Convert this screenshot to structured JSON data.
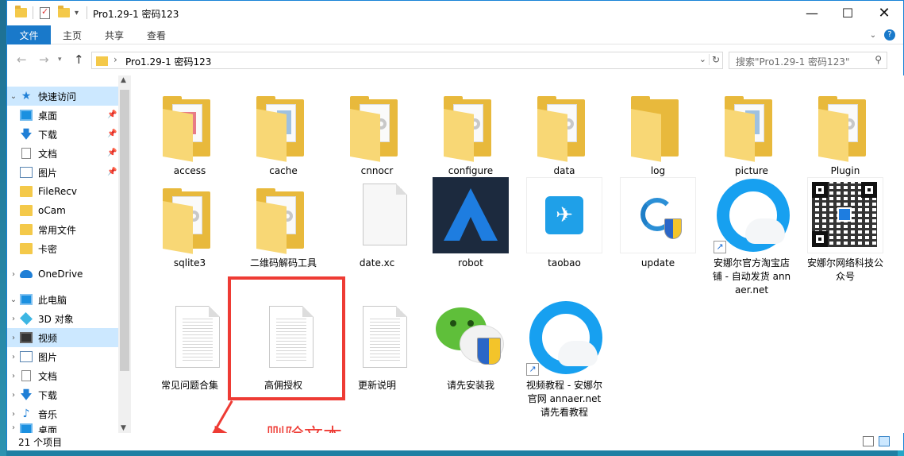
{
  "window": {
    "title": "Pro1.29-1 密码123",
    "controls": [
      "minimize",
      "maximize",
      "close"
    ]
  },
  "ribbon": {
    "tabs": [
      {
        "label": "文件",
        "active": true
      },
      {
        "label": "主页"
      },
      {
        "label": "共享"
      },
      {
        "label": "查看"
      }
    ]
  },
  "address": {
    "path": "Pro1.29-1 密码123",
    "separator": "›"
  },
  "search": {
    "placeholder": "搜索\"Pro1.29-1 密码123\""
  },
  "nav": {
    "quick_access": "快速访问",
    "items": [
      {
        "label": "桌面",
        "pinned": true
      },
      {
        "label": "下载",
        "pinned": true
      },
      {
        "label": "文档",
        "pinned": true
      },
      {
        "label": "图片",
        "pinned": true
      },
      {
        "label": "FileRecv"
      },
      {
        "label": "oCam"
      },
      {
        "label": "常用文件"
      },
      {
        "label": "卡密"
      }
    ],
    "onedrive": "OneDrive",
    "this_pc": "此电脑",
    "pc_items": [
      {
        "label": "3D 对象"
      },
      {
        "label": "视频",
        "selected": true
      },
      {
        "label": "图片"
      },
      {
        "label": "文档"
      },
      {
        "label": "下载"
      },
      {
        "label": "音乐"
      },
      {
        "label": "桌面"
      }
    ]
  },
  "files": [
    {
      "name": "access",
      "type": "folder",
      "variant": "red"
    },
    {
      "name": "cache",
      "type": "folder",
      "variant": "blue"
    },
    {
      "name": "cnnocr",
      "type": "folder",
      "variant": "gear"
    },
    {
      "name": "configure",
      "type": "folder",
      "variant": "gear"
    },
    {
      "name": "data",
      "type": "folder",
      "variant": "gear"
    },
    {
      "name": "log",
      "type": "folder",
      "variant": "empty"
    },
    {
      "name": "picture",
      "type": "folder",
      "variant": "blue"
    },
    {
      "name": "Plugin",
      "type": "folder",
      "variant": "gear"
    },
    {
      "name": "sqlite3",
      "type": "folder",
      "variant": "gear"
    },
    {
      "name": "二维码解码工具",
      "type": "folder",
      "variant": "gear"
    },
    {
      "name": "date.xc",
      "type": "blank"
    },
    {
      "name": "robot",
      "type": "robot"
    },
    {
      "name": "taobao",
      "type": "taobao"
    },
    {
      "name": "update",
      "type": "update"
    },
    {
      "name": "安娜尔官方淘宝店铺 - 自动发货 annaer.net",
      "type": "browser"
    },
    {
      "name": "安娜尔网络科技公众号",
      "type": "qr"
    },
    {
      "name": "常见问题合集",
      "type": "text"
    },
    {
      "name": "高佣授权",
      "type": "text"
    },
    {
      "name": "更新说明",
      "type": "text"
    },
    {
      "name": "请先安装我",
      "type": "wechat"
    },
    {
      "name": "视频教程 - 安娜尔官网 annaer.net 请先看教程",
      "type": "browser"
    }
  ],
  "annotation": {
    "text": "删除文本",
    "color": "#ee3b34"
  },
  "status": {
    "item_count": "21 个项目"
  },
  "colors": {
    "accent": "#1979ca",
    "folder": "#f4c94a",
    "selection": "#cce8ff"
  }
}
